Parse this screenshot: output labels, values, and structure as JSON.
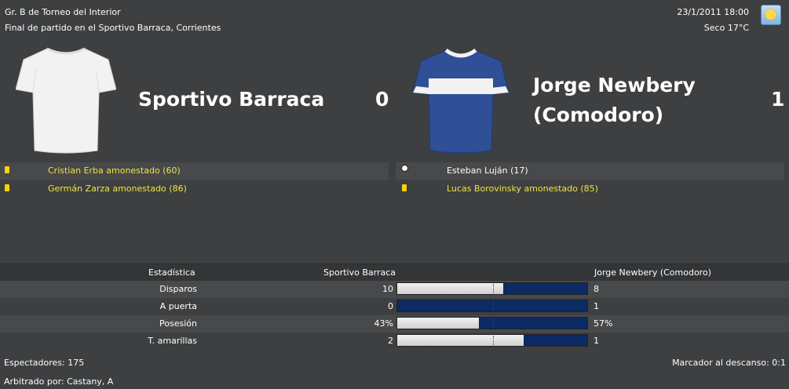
{
  "header": {
    "competition": "Gr. B de Torneo del Interior",
    "subtitle": "Final de partido en el Sportivo Barraca, Corrientes",
    "datetime": "23/1/2011 18:00",
    "weather": "Seco 17°C",
    "weather_icon": "sun-icon"
  },
  "home": {
    "name": "Sportivo Barraca",
    "score": "0",
    "shirt_color": "#f2f2f2",
    "events": [
      {
        "icon": "yellow-card-icon",
        "text": "Cristian Erba amonestado (60)"
      },
      {
        "icon": "yellow-card-icon",
        "text": "Germán Zarza amonestado (86)"
      }
    ]
  },
  "away": {
    "name_line1": "Jorge Newbery",
    "name_line2": "(Comodoro)",
    "score": "1",
    "shirt_color": "#2f4f96",
    "events": [
      {
        "icon": "ball-icon",
        "text": "Esteban Luján (17)"
      },
      {
        "icon": "yellow-card-icon",
        "text": "Lucas Borovinsky amonestado (85)"
      }
    ]
  },
  "stats": {
    "header": {
      "label": "Estadística",
      "home": "Sportivo Barraca",
      "away": "Jorge Newbery (Comodoro)"
    },
    "rows": [
      {
        "label": "Disparos",
        "home": "10",
        "away": "8",
        "home_share": 0.556
      },
      {
        "label": "A puerta",
        "home": "0",
        "away": "1",
        "home_share": 0.0
      },
      {
        "label": "Posesión",
        "home": "43%",
        "away": "57%",
        "home_share": 0.43
      },
      {
        "label": "T. amarillas",
        "home": "2",
        "away": "1",
        "home_share": 0.667
      }
    ]
  },
  "footer": {
    "attendance": "Espectadores: 175",
    "referee": "Arbitrado por: Castany, A",
    "halftime": "Marcador al descanso: 0:1"
  },
  "colors": {
    "card": "#f5d400",
    "event_text": "#f0e442",
    "bar_away": "#0c2a63"
  }
}
